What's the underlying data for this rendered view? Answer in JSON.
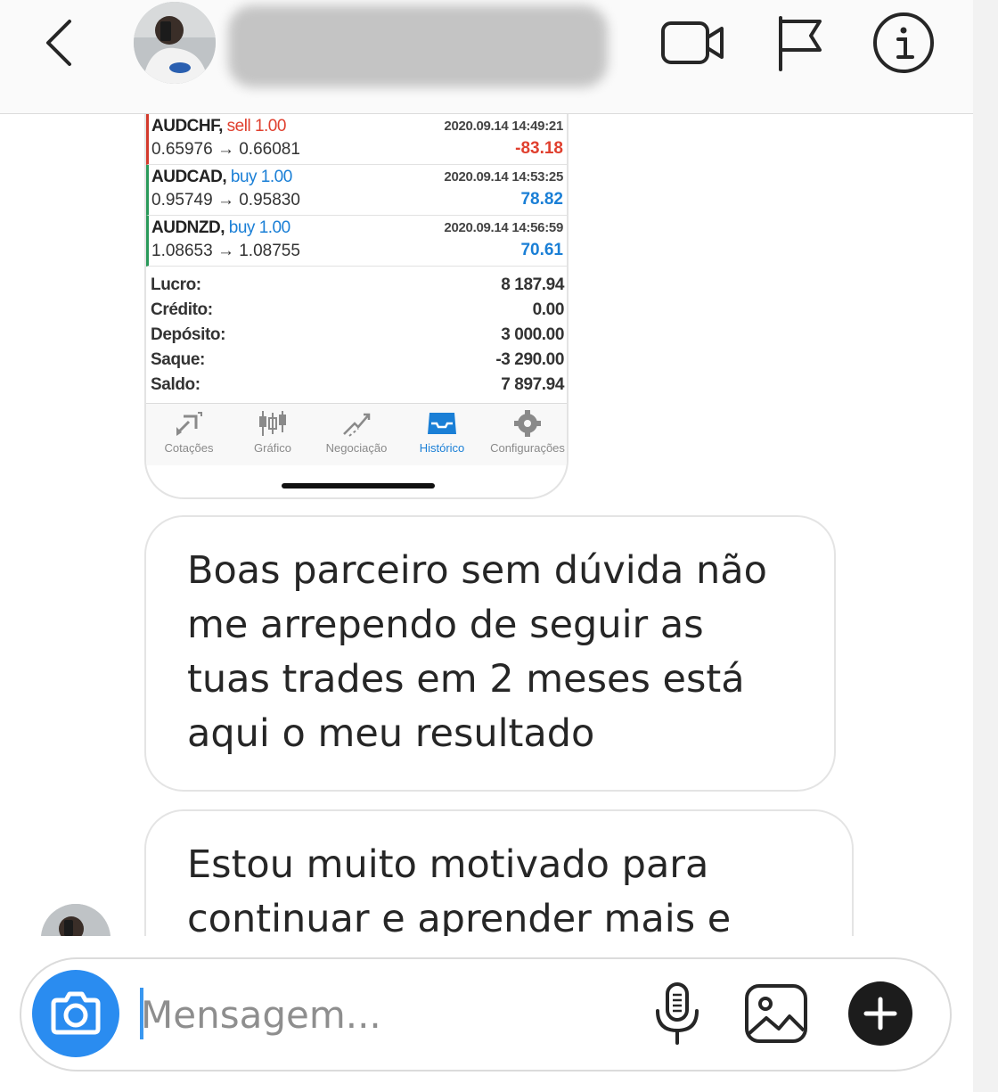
{
  "header": {
    "username": "",
    "icons": [
      "chevron-left-icon",
      "video-camera-icon",
      "flag-icon",
      "info-icon"
    ]
  },
  "history": {
    "trades": [
      {
        "symbol": "AUDCHF,",
        "side": "sell",
        "volume": "1.00",
        "side_label": "sell 1.00",
        "prices": "0.65976 → 0.66081",
        "time": "2020.09.14 14:49:21",
        "profit": "-83.18"
      },
      {
        "symbol": "AUDCAD,",
        "side": "buy",
        "volume": "1.00",
        "side_label": "buy 1.00",
        "prices": "0.95749 → 0.95830",
        "time": "2020.09.14 14:53:25",
        "profit": "78.82"
      },
      {
        "symbol": "AUDNZD,",
        "side": "buy",
        "volume": "1.00",
        "side_label": "buy 1.00",
        "prices": "1.08653 → 1.08755",
        "time": "2020.09.14 14:56:59",
        "profit": "70.61"
      }
    ],
    "summary": [
      {
        "label": "Lucro:",
        "value": "8 187.94"
      },
      {
        "label": "Crédito:",
        "value": "0.00"
      },
      {
        "label": "Depósito:",
        "value": "3 000.00"
      },
      {
        "label": "Saque:",
        "value": "-3 290.00"
      },
      {
        "label": "Saldo:",
        "value": "7 897.94"
      }
    ],
    "tabs": [
      {
        "label": "Cotações",
        "icon": "quotes-icon"
      },
      {
        "label": "Gráfico",
        "icon": "candlestick-icon"
      },
      {
        "label": "Negociação",
        "icon": "trade-icon"
      },
      {
        "label": "Histórico",
        "icon": "inbox-icon",
        "active": true
      },
      {
        "label": "Configurações",
        "icon": "gear-icon"
      }
    ]
  },
  "messages": [
    {
      "text": "Boas parceiro sem dúvida não me arrependo de seguir as tuas trades em 2 meses está aqui o meu resultado"
    },
    {
      "text": "Estou muito motivado para continuar e aprender mais e mais"
    }
  ],
  "composer": {
    "placeholder": "Mensagem...",
    "icons": [
      "camera-icon",
      "microphone-icon",
      "image-icon",
      "plus-icon"
    ]
  },
  "colors": {
    "sell": "#e0402f",
    "buy": "#1a7fd6",
    "accent_blue": "#2a8cf0",
    "active_tab": "#1a7fd6"
  }
}
